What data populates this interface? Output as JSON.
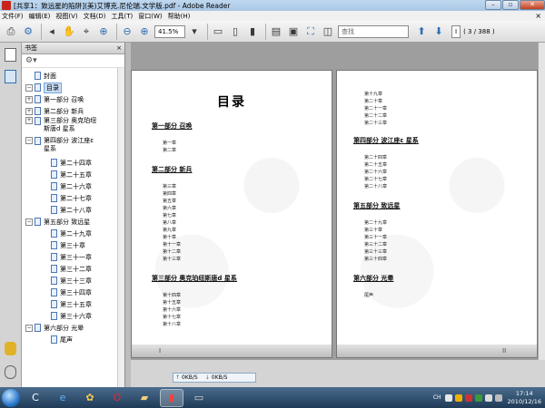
{
  "window": {
    "title": "[共享1：致远星的陷阱](美)艾博克.尼伦瑞.文学版.pdf - Adobe Reader",
    "minimize": "–",
    "maximize": "▫",
    "close": "✕"
  },
  "menu": {
    "items": [
      "文件(F)",
      "编辑(E)",
      "视图(V)",
      "文档(D)",
      "工具(T)",
      "窗口(W)",
      "帮助(H)"
    ],
    "close": "×"
  },
  "toolbar": {
    "zoom": "41.5%",
    "find_placeholder": "查找",
    "page_current": "I",
    "page_total": "( 3 / 388 )"
  },
  "bookmarks": {
    "header": "书签",
    "close": "×",
    "items": [
      {
        "label": "封面",
        "toggle": ""
      },
      {
        "label": "目录",
        "toggle": "−",
        "selected": true
      },
      {
        "label": "第一部分  召唤",
        "toggle": "+"
      },
      {
        "label": "第二部分  新兵",
        "toggle": "+"
      },
      {
        "label": "第三部分  奥克珀纽斯唐d 星系",
        "toggle": "+"
      },
      {
        "label": "第四部分  波江座ε 星系",
        "toggle": "−"
      },
      {
        "label": "第二十四章",
        "toggle": ""
      },
      {
        "label": "第二十五章",
        "toggle": ""
      },
      {
        "label": "第二十六章",
        "toggle": ""
      },
      {
        "label": "第二十七章",
        "toggle": ""
      },
      {
        "label": "第二十八章",
        "toggle": ""
      },
      {
        "label": "第五部分  致远星",
        "toggle": "−"
      },
      {
        "label": "第二十九章",
        "toggle": ""
      },
      {
        "label": "第三十章",
        "toggle": ""
      },
      {
        "label": "第三十一章",
        "toggle": ""
      },
      {
        "label": "第三十二章",
        "toggle": ""
      },
      {
        "label": "第三十三章",
        "toggle": ""
      },
      {
        "label": "第三十四章",
        "toggle": ""
      },
      {
        "label": "第三十五章",
        "toggle": ""
      },
      {
        "label": "第三十六章",
        "toggle": ""
      },
      {
        "label": "第六部分  光晕",
        "toggle": "−"
      },
      {
        "label": "尾声",
        "toggle": ""
      }
    ]
  },
  "document": {
    "left_page": {
      "title": "目录",
      "parts": [
        {
          "heading": "第一部分 召唤",
          "chapters": [
            "第一章",
            "第二章"
          ]
        },
        {
          "heading": "第二部分 新兵",
          "chapters": [
            "第三章",
            "第四章",
            "第五章",
            "第六章",
            "第七章",
            "第八章",
            "第九章",
            "第十章",
            "第十一章",
            "第十二章",
            "第十三章"
          ]
        },
        {
          "heading": "第三部分 奥克珀纽斯唐d 星系",
          "chapters": [
            "第十四章",
            "第十五章",
            "第十六章",
            "第十七章",
            "第十八章"
          ]
        }
      ],
      "page_number": "I"
    },
    "right_page": {
      "top_chapters": [
        "第十九章",
        "第二十章",
        "第二十一章",
        "第二十二章",
        "第二十三章"
      ],
      "parts": [
        {
          "heading": "第四部分 波江座ε 星系",
          "chapters": [
            "第二十四章",
            "第二十五章",
            "第二十六章",
            "第二十七章",
            "第二十八章"
          ]
        },
        {
          "heading": "第五部分 致远星",
          "chapters": [
            "第二十九章",
            "第三十章",
            "第三十一章",
            "第三十二章",
            "第三十三章",
            "第三十四章"
          ]
        },
        {
          "heading": "第六部分 光晕",
          "chapters": [
            "尾声"
          ]
        }
      ],
      "page_number": "II"
    }
  },
  "status": {
    "upload": "0KB/S",
    "download": "0KB/S"
  },
  "taskbar": {
    "lang": "CH",
    "time": "17:14",
    "date": "2010/12/16"
  }
}
